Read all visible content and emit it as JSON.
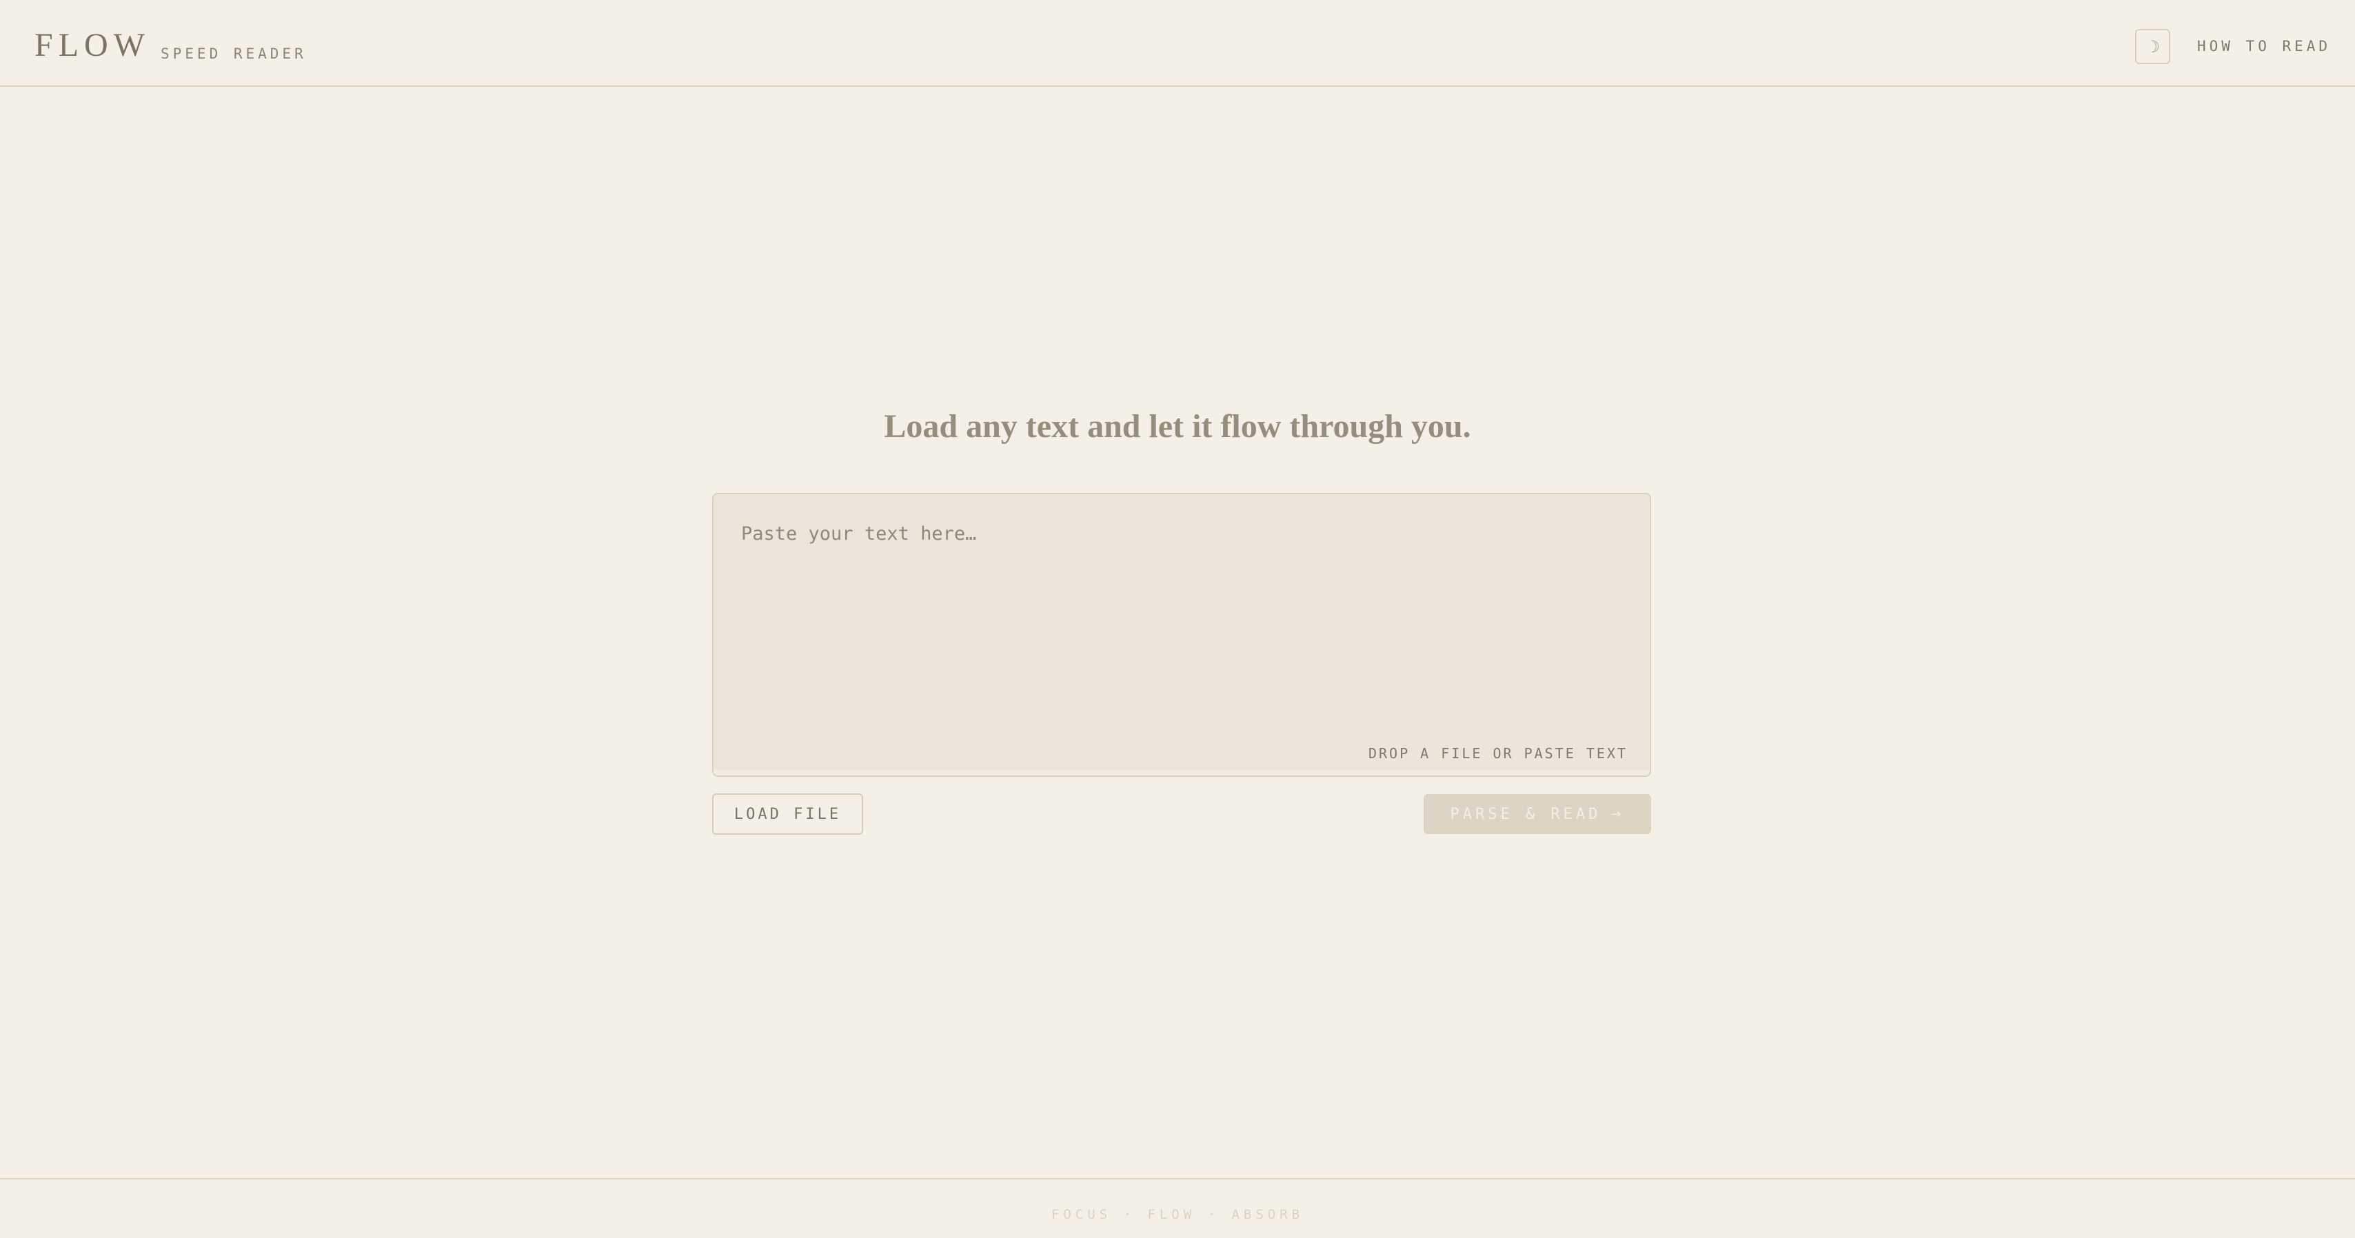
{
  "header": {
    "logo": "FLOW",
    "subtitle": "SPEED READER",
    "theme_icon": "moon-icon",
    "theme_glyph": "☽",
    "how_to_read": "HOW TO READ"
  },
  "main": {
    "tagline": "Load any text and let it flow through you.",
    "input_placeholder": "Paste your text here…",
    "input_value": "",
    "drop_hint": "DROP A FILE OR PASTE TEXT",
    "load_file": "LOAD FILE",
    "parse_read": "PARSE & READ",
    "parse_arrow": "→"
  },
  "footer": {
    "text": "FOCUS · FLOW · ABSORB"
  },
  "colors": {
    "background": "#f4f0e7",
    "input_background": "#ece5d9",
    "border": "#ddd4bd",
    "primary_button_disabled": "#ddd4c3",
    "text_muted": "#8e8876"
  }
}
